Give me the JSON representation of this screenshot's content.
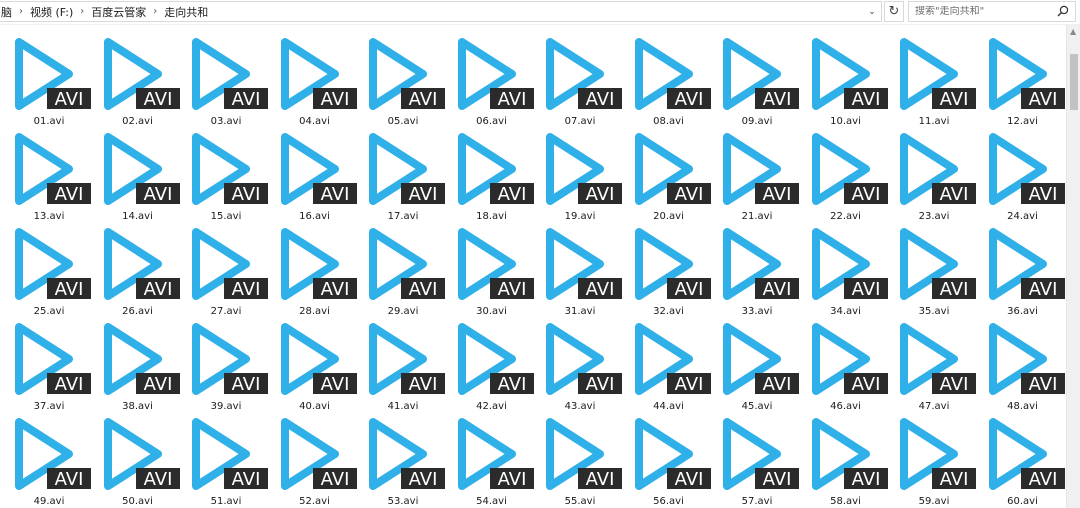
{
  "address_bar": {
    "crumbs": [
      "脑",
      "视频 (F:)",
      "百度云管家",
      "走向共和"
    ],
    "dropdown_glyph": "⌄",
    "refresh_glyph": "↻"
  },
  "search": {
    "placeholder": "搜索\"走向共和\""
  },
  "icons": {
    "video_badge": "AVI",
    "accent": "#2fb0e8",
    "badge_bg": "#2b2b2b"
  },
  "files": [
    "01.avi",
    "02.avi",
    "03.avi",
    "04.avi",
    "05.avi",
    "06.avi",
    "07.avi",
    "08.avi",
    "09.avi",
    "10.avi",
    "11.avi",
    "12.avi",
    "13.avi",
    "14.avi",
    "15.avi",
    "16.avi",
    "17.avi",
    "18.avi",
    "19.avi",
    "20.avi",
    "21.avi",
    "22.avi",
    "23.avi",
    "24.avi",
    "25.avi",
    "26.avi",
    "27.avi",
    "28.avi",
    "29.avi",
    "30.avi",
    "31.avi",
    "32.avi",
    "33.avi",
    "34.avi",
    "35.avi",
    "36.avi",
    "37.avi",
    "38.avi",
    "39.avi",
    "40.avi",
    "41.avi",
    "42.avi",
    "43.avi",
    "44.avi",
    "45.avi",
    "46.avi",
    "47.avi",
    "48.avi",
    "49.avi",
    "50.avi",
    "51.avi",
    "52.avi",
    "53.avi",
    "54.avi",
    "55.avi",
    "56.avi",
    "57.avi",
    "58.avi",
    "59.avi",
    "60.avi"
  ]
}
